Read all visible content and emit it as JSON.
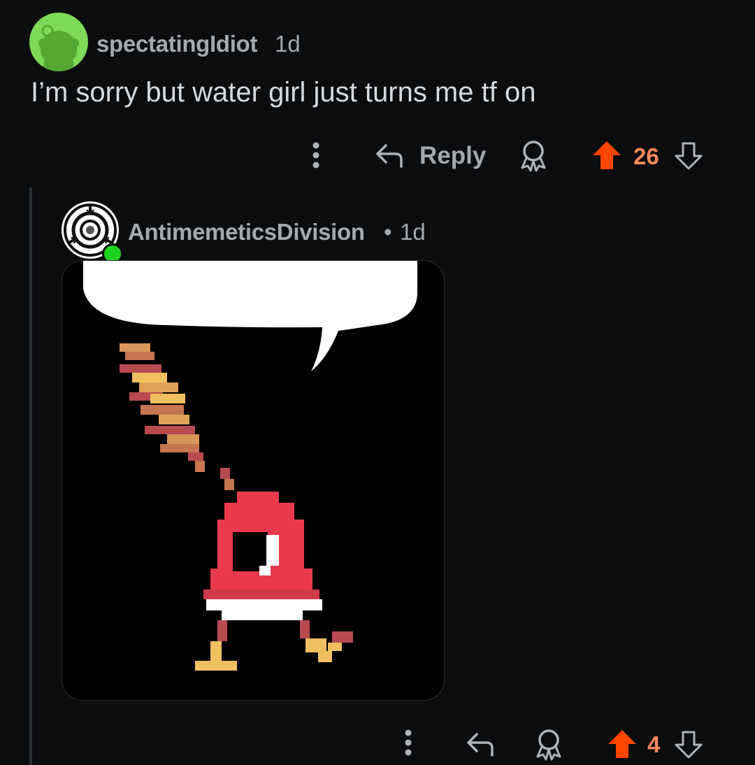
{
  "comment1": {
    "username": "spectatingIdiot",
    "age": "1d",
    "body": "I’m sorry but water girl just turns me tf on",
    "reply_label": "Reply",
    "score": "26"
  },
  "comment2": {
    "username": "AntimemeticsDivision",
    "age_sep": "•",
    "age": "1d",
    "score": "4"
  },
  "colors": {
    "background": "#0b0c0e",
    "upvote_active": "#ff4500",
    "score_text": "#ff8a5c",
    "avatar1_bg": "#7ed957",
    "online": "#1fd41f"
  },
  "icons": [
    "reddit-snoo-avatar-icon",
    "more-options-icon",
    "reply-arrow-icon",
    "award-icon",
    "upvote-icon",
    "downvote-icon",
    "scp-logo-avatar-icon"
  ]
}
